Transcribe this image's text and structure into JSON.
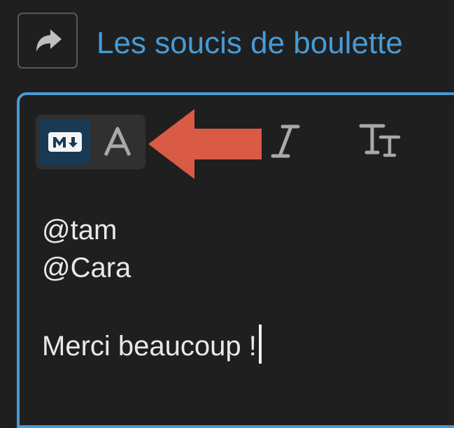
{
  "header": {
    "reply_icon": "reply-arrow-icon",
    "title": "Les soucis de boulette"
  },
  "toolbar": {
    "markdown_mode_icon": "markdown-icon",
    "rich_text_mode_label": "A",
    "annotation_arrow_color": "#d95a45",
    "italic_label": "I",
    "heading_label": "Tт",
    "heading_icon": "text-size-icon"
  },
  "editor": {
    "lines": [
      "@tam",
      "@Cara",
      "",
      "Merci beaucoup !"
    ]
  },
  "colors": {
    "background": "#1f1f20",
    "accent": "#479bd5",
    "markdown_active": "#183a55",
    "annotation_arrow": "#d95a45"
  }
}
